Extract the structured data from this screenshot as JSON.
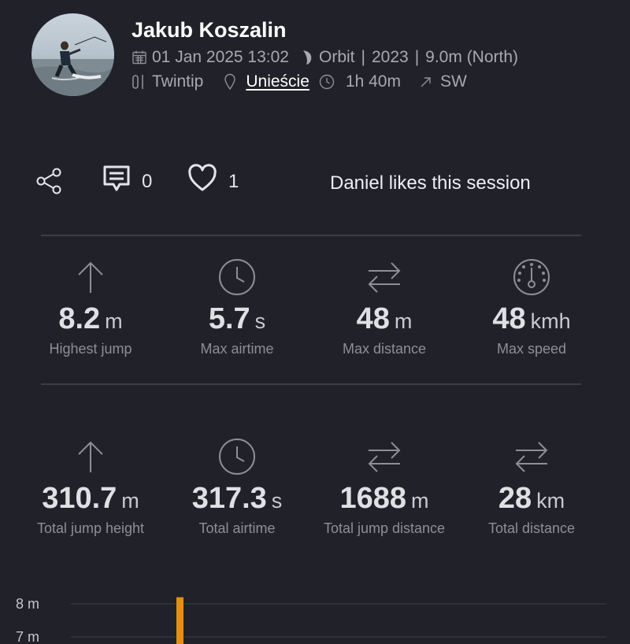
{
  "header": {
    "user_name": "Jakub Koszalin",
    "date": "01 Jan 2025 13:02",
    "kite_brand": "Orbit",
    "kite_year": "2023",
    "kite_size": "9.0m (North)",
    "board_type": "Twintip",
    "location": "Unieście",
    "duration": "1h 40m",
    "wind_direction": "SW",
    "icons": {
      "date": "calendar-icon",
      "kite": "kite-icon",
      "board": "board-icon",
      "location": "map-pin-icon",
      "duration": "clock-icon",
      "wind": "arrow-up-right-icon"
    }
  },
  "social": {
    "share_icon": "share-icon",
    "comment_count": "0",
    "like_count": "1",
    "likes_text": "Daniel likes this session"
  },
  "stats_max": [
    {
      "icon": "arrow-up-icon",
      "value": "8.2",
      "unit": "m",
      "label": "Highest jump"
    },
    {
      "icon": "clock-icon",
      "value": "5.7",
      "unit": "s",
      "label": "Max airtime"
    },
    {
      "icon": "swap-arrows-icon",
      "value": "48",
      "unit": "m",
      "label": "Max distance"
    },
    {
      "icon": "speedometer-icon",
      "value": "48",
      "unit": "kmh",
      "label": "Max speed"
    }
  ],
  "stats_total": [
    {
      "icon": "arrow-up-icon",
      "value": "310.7",
      "unit": "m",
      "label": "Total jump height"
    },
    {
      "icon": "clock-icon",
      "value": "317.3",
      "unit": "s",
      "label": "Total airtime"
    },
    {
      "icon": "swap-arrows-icon",
      "value": "1688",
      "unit": "m",
      "label": "Total jump distance"
    },
    {
      "icon": "swap-arrows-icon",
      "value": "28",
      "unit": "km",
      "label": "Total distance"
    }
  ],
  "chart_data": {
    "type": "bar",
    "y_tick_labels": [
      "8 m",
      "7 m"
    ],
    "y_ticks": [
      8,
      7
    ],
    "bar_color": "#e58e12",
    "values": [
      8.2
    ]
  },
  "colors": {
    "background": "#212229",
    "accent_bar": "#e58e12"
  }
}
